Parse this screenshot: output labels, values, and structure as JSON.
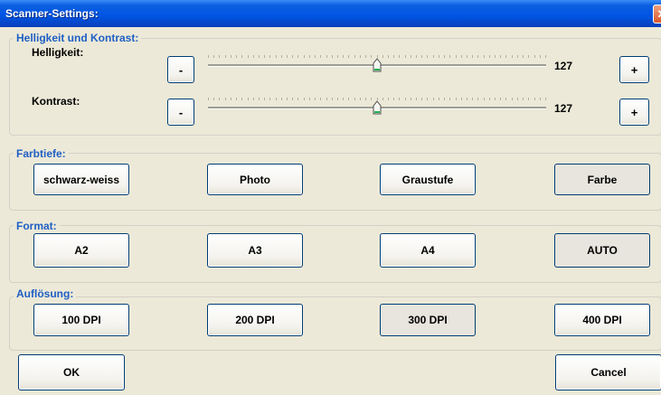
{
  "window": {
    "title": "Scanner-Settings:"
  },
  "brightness_contrast": {
    "legend": "Helligkeit und Kontrast:",
    "brightness": {
      "label": "Helligkeit:",
      "value": "127",
      "minus": "-",
      "plus": "+",
      "level": 0.5
    },
    "contrast": {
      "label": "Kontrast:",
      "value": "127",
      "minus": "-",
      "plus": "+",
      "level": 0.5
    }
  },
  "color_depth": {
    "legend": "Farbtiefe:",
    "options": [
      "schwarz-weiss",
      "Photo",
      "Graustufe",
      "Farbe"
    ],
    "selected": "Farbe"
  },
  "format": {
    "legend": "Format:",
    "options": [
      "A2",
      "A3",
      "A4",
      "AUTO"
    ],
    "selected": "AUTO"
  },
  "resolution": {
    "legend": "Auflösung:",
    "options": [
      "100 DPI",
      "200 DPI",
      "300 DPI",
      "400 DPI"
    ],
    "selected": "300 DPI"
  },
  "footer": {
    "ok": "OK",
    "cancel": "Cancel"
  }
}
